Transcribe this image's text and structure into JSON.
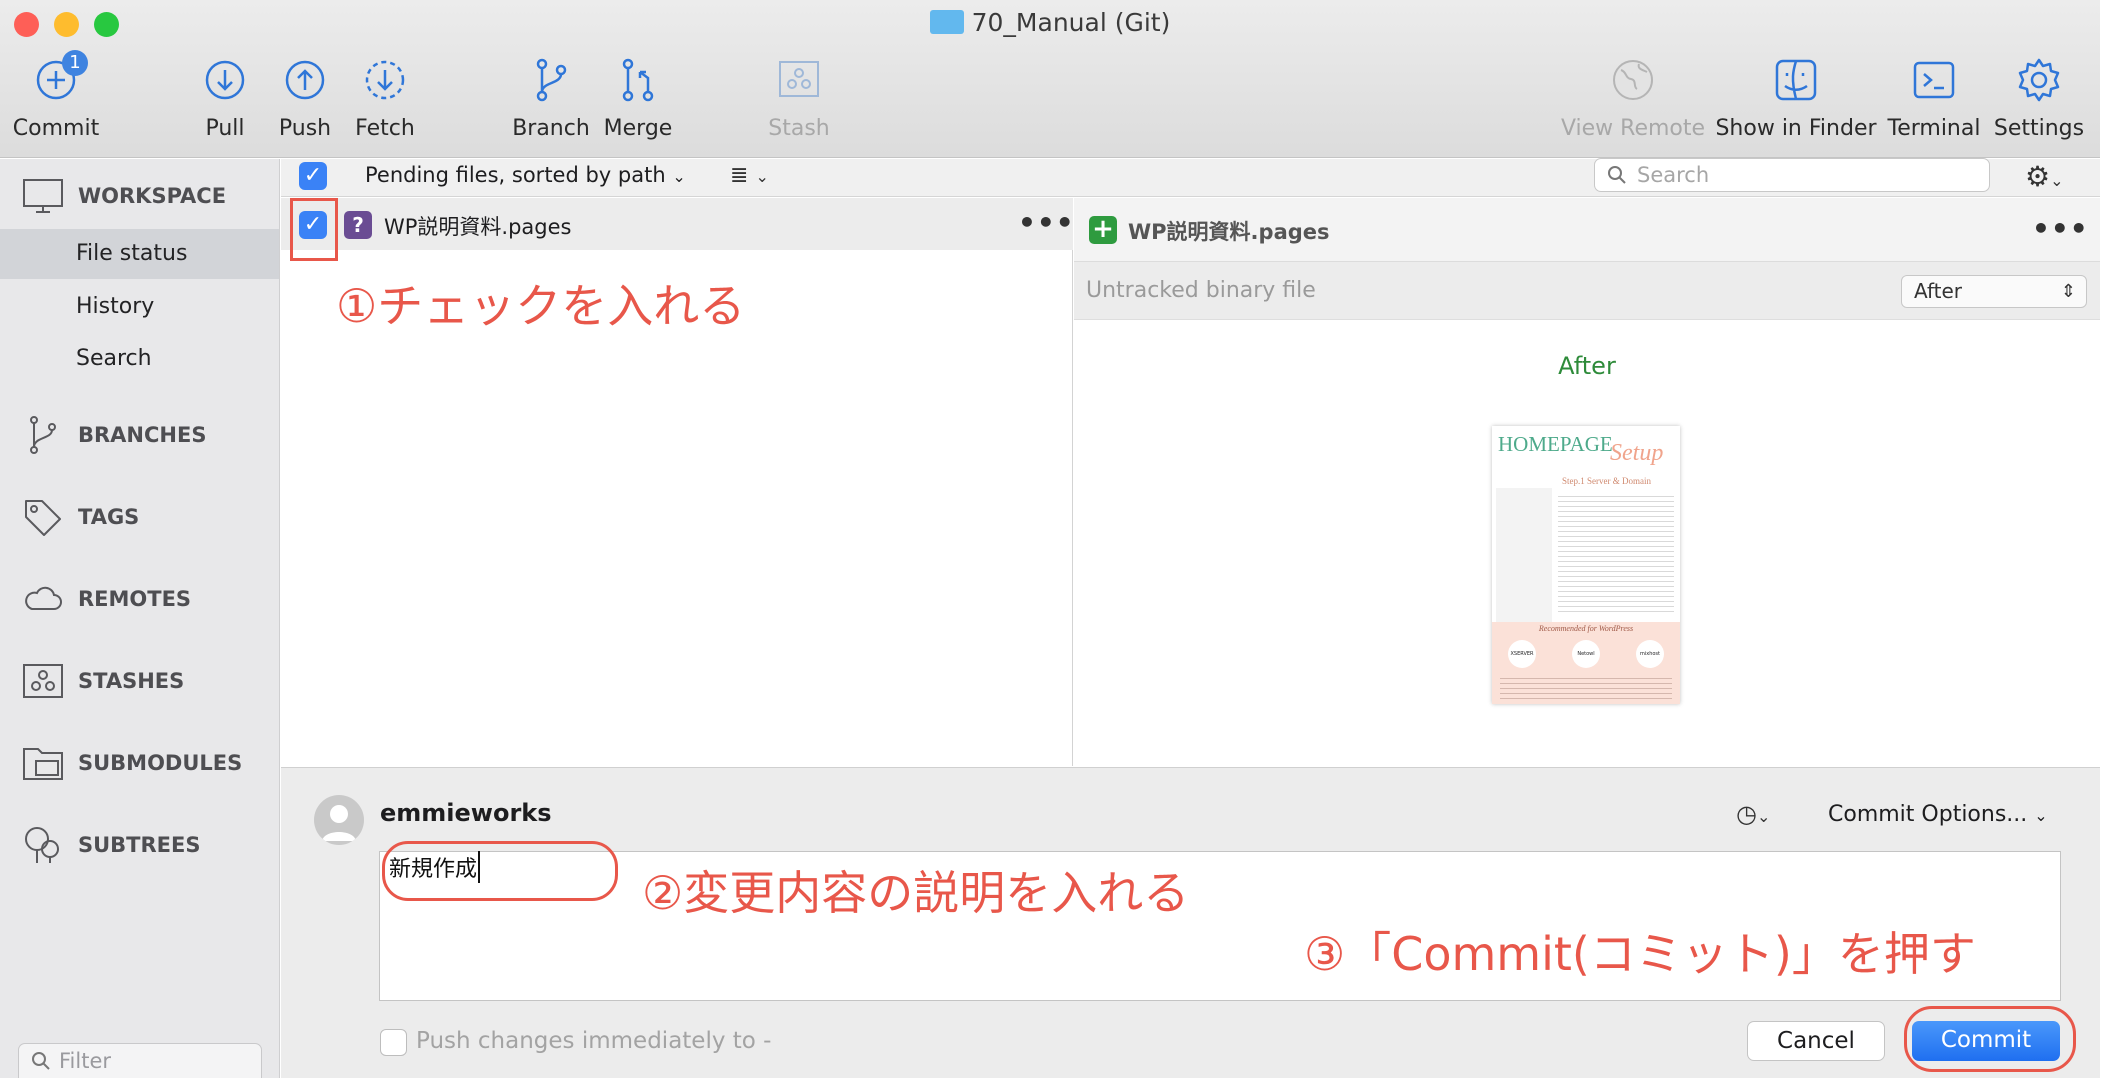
{
  "window": {
    "title": "70_Manual (Git)"
  },
  "toolbar": {
    "commit": {
      "label": "Commit",
      "badge": "1"
    },
    "pull": "Pull",
    "push": "Push",
    "fetch": "Fetch",
    "branch": "Branch",
    "merge": "Merge",
    "stash": "Stash",
    "view_remote": "View Remote",
    "show_in_finder": "Show in Finder",
    "terminal": "Terminal",
    "settings": "Settings"
  },
  "sidebar": {
    "workspace": "WORKSPACE",
    "items": [
      "File status",
      "History",
      "Search"
    ],
    "branches": "BRANCHES",
    "tags": "TAGS",
    "remotes": "REMOTES",
    "stashes": "STASHES",
    "submodules": "SUBMODULES",
    "subtrees": "SUBTREES",
    "filter_placeholder": "Filter"
  },
  "filelist": {
    "sort_label": "Pending files, sorted by path",
    "search_placeholder": "Search",
    "file_name": "WP説明資料.pages"
  },
  "diff": {
    "file_name": "WP説明資料.pages",
    "status": "Untracked binary file",
    "view_select": "After",
    "heading": "After"
  },
  "commit": {
    "author": "emmieworks",
    "options_label": "Commit Options...",
    "message": "新規作成",
    "push_label": "Push changes immediately to -",
    "cancel_label": "Cancel",
    "commit_label": "Commit"
  },
  "annotations": {
    "step1": "①チェックを入れる",
    "step2": "②変更内容の説明を入れる",
    "step3": "③「Commit(コミット)」を押す"
  },
  "thumbnail": {
    "title_main": "HOMEPAGE",
    "title_script": "Setup",
    "subtitle": "Step.1 Server & Domain",
    "banner": "Recommended for WordPress",
    "logos": [
      "XSERVER",
      "Netowl",
      "mixhost"
    ]
  },
  "colors": {
    "accent": "#3a82f6",
    "annotation": "#e8574a",
    "add": "#2e9b3f"
  }
}
